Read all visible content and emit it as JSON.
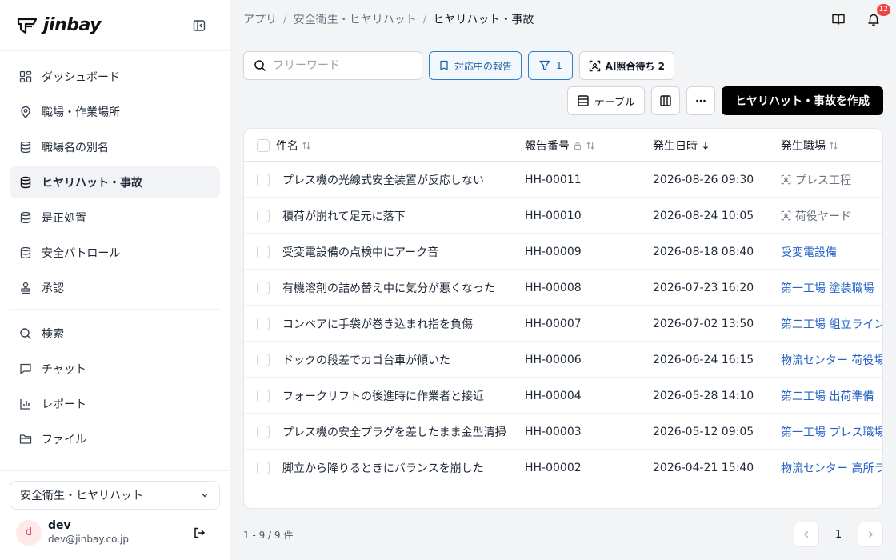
{
  "app": {
    "logo_text": "jinbay"
  },
  "sidebar": {
    "items": [
      {
        "label": "ダッシュボード",
        "icon": "dashboard-icon"
      },
      {
        "label": "職場・作業場所",
        "icon": "map-pin-icon"
      },
      {
        "label": "職場名の別名",
        "icon": "database-icon"
      },
      {
        "label": "ヒヤリハット・事故",
        "icon": "database-icon",
        "active": true
      },
      {
        "label": "是正処置",
        "icon": "database-icon"
      },
      {
        "label": "安全パトロール",
        "icon": "database-icon"
      },
      {
        "label": "承認",
        "icon": "stamp-icon"
      }
    ],
    "items2": [
      {
        "label": "検索",
        "icon": "search-icon"
      },
      {
        "label": "チャット",
        "icon": "chat-icon"
      },
      {
        "label": "レポート",
        "icon": "bar-chart-icon"
      },
      {
        "label": "ファイル",
        "icon": "folder-icon"
      }
    ],
    "workspace": "安全衛生・ヒヤリハット",
    "user": {
      "initial": "d",
      "name": "dev",
      "email": "dev@jinbay.co.jp"
    }
  },
  "header": {
    "breadcrumb": [
      "アプリ",
      "安全衛生・ヒヤリハット",
      "ヒヤリハット・事故"
    ],
    "notification_count": "12"
  },
  "toolbar": {
    "search_placeholder": "フリーワード",
    "active_reports_label": "対応中の報告",
    "filter_count": "1",
    "ai_pending_label": "AI照合待ち 2",
    "table_view_label": "テーブル",
    "create_label": "ヒヤリハット・事故を作成"
  },
  "table": {
    "columns": [
      "件名",
      "報告番号",
      "発生日時",
      "発生職場"
    ],
    "rows": [
      {
        "title": "プレス機の光線式安全装置が反応しない",
        "number": "HH-00011",
        "date": "2026-08-26 09:30",
        "place": "プレス工程",
        "pending": true
      },
      {
        "title": "積荷が崩れて足元に落下",
        "number": "HH-00010",
        "date": "2026-08-24 10:05",
        "place": "荷役ヤード",
        "pending": true
      },
      {
        "title": "受変電設備の点検中にアーク音",
        "number": "HH-00009",
        "date": "2026-08-18 08:40",
        "place": "受変電設備",
        "pending": false
      },
      {
        "title": "有機溶剤の詰め替え中に気分が悪くなった",
        "number": "HH-00008",
        "date": "2026-07-23 16:20",
        "place": "第一工場 塗装職場",
        "pending": false
      },
      {
        "title": "コンベアに手袋が巻き込まれ指を負傷",
        "number": "HH-00007",
        "date": "2026-07-02 13:50",
        "place": "第二工場 組立ライン",
        "pending": false
      },
      {
        "title": "ドックの段差でカゴ台車が傾いた",
        "number": "HH-00006",
        "date": "2026-06-24 16:15",
        "place": "物流センター 荷役場",
        "pending": false
      },
      {
        "title": "フォークリフトの後進時に作業者と接近",
        "number": "HH-00004",
        "date": "2026-05-28 14:10",
        "place": "第二工場 出荷準備",
        "pending": false
      },
      {
        "title": "プレス機の安全プラグを差したまま金型清掃",
        "number": "HH-00003",
        "date": "2026-05-12 09:05",
        "place": "第一工場 プレス職場",
        "pending": false
      },
      {
        "title": "脚立から降りるときにバランスを崩した",
        "number": "HH-00002",
        "date": "2026-04-21 15:40",
        "place": "物流センター 高所ラック",
        "pending": false
      }
    ]
  },
  "footer": {
    "count_label": "1 - 9 / 9 件",
    "page": "1"
  },
  "colors": {
    "accent_blue": "#2563c9",
    "badge_red": "#ef4444",
    "primary_black": "#000000"
  }
}
